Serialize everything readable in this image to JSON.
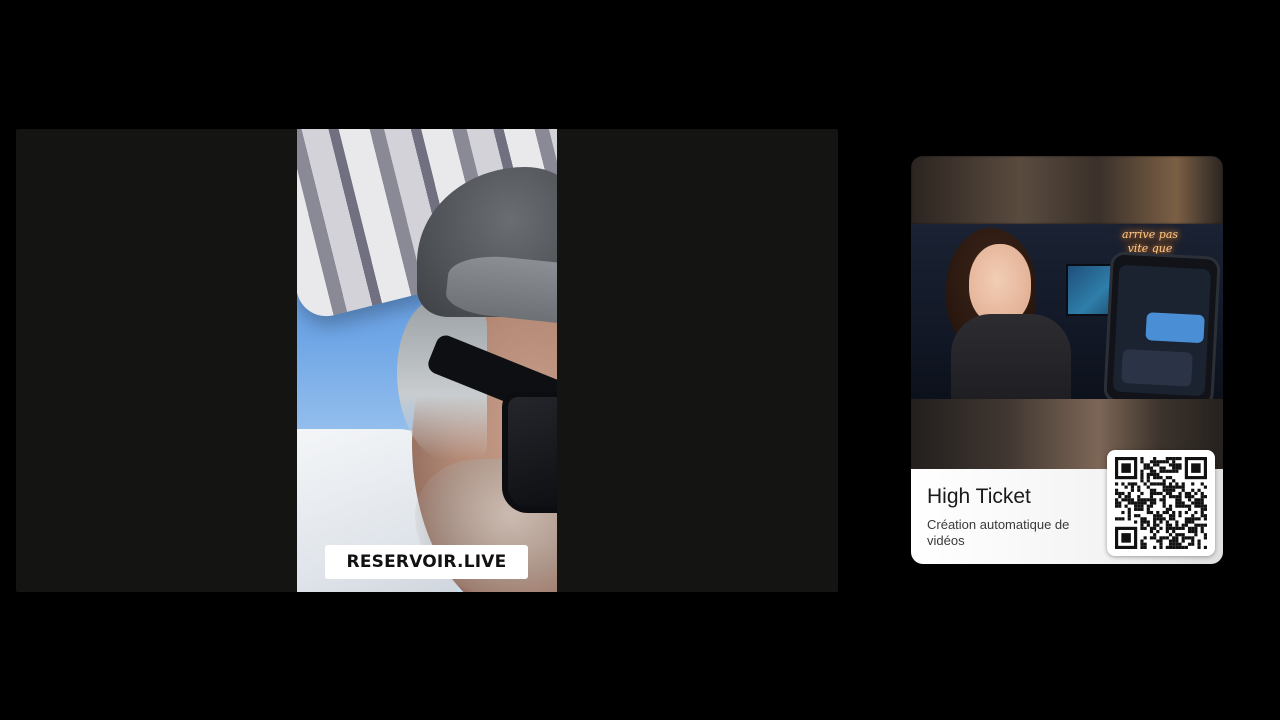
{
  "video": {
    "caption": "RESERVOIR.LIVE"
  },
  "card": {
    "thumbnail": {
      "neon_text": "arrive pas\nvite que prévu"
    },
    "title": "High Ticket",
    "subtitle": "Création automatique de vidéos",
    "qr_icon": "qr-code-icon"
  }
}
